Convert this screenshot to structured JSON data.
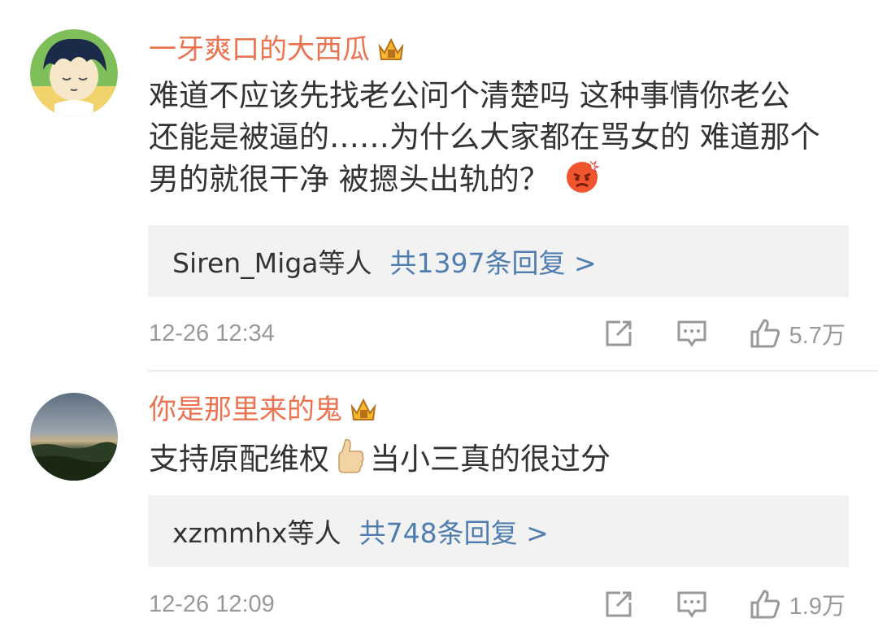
{
  "comments": [
    {
      "username": "一牙爽口的大西瓜",
      "text_lines": [
        "难道不应该先找老公问个清楚吗 这种事情你老公",
        "还能是被逼的……为什么大家都在骂女的 难道那个",
        "男的就很干净 被摁头出轨的？"
      ],
      "emoji": "angry-face-icon",
      "replies": {
        "others": "Siren_Miga等人",
        "count": "共1397条回复 >"
      },
      "time": "12-26 12:34",
      "likes": "5.7万"
    },
    {
      "username": "你是那里来的鬼",
      "text_before_emoji": "支持原配维权",
      "emoji": "thumbs-up-icon",
      "text_after_emoji": "当小三真的很过分",
      "replies": {
        "others": "xzmmhx等人",
        "count": "共748条回复 >"
      },
      "time": "12-26 12:09",
      "likes": "1.9万"
    }
  ],
  "colors": {
    "username": "#eb7350",
    "link": "#507daf",
    "reply_bg": "#f2f2f2",
    "meta": "#999999"
  }
}
